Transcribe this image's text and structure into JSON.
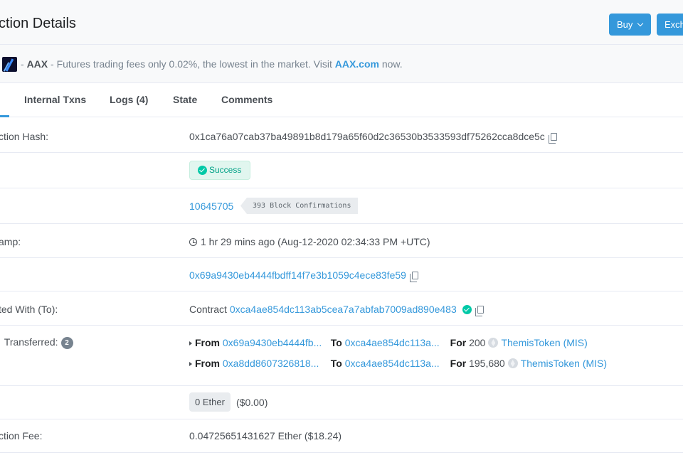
{
  "header": {
    "title": "ction Details",
    "buy_label": "Buy",
    "exchange_label": "Exch"
  },
  "sponsor": {
    "separator": "-",
    "brand": "AAX",
    "message": "- Futures trading fees only 0.02%, the lowest in the market. Visit",
    "link": "AAX.com",
    "suffix": "now."
  },
  "tabs": [
    {
      "label": "Internal Txns"
    },
    {
      "label": "Logs (4)"
    },
    {
      "label": "State"
    },
    {
      "label": "Comments"
    }
  ],
  "fields": {
    "tx_hash": {
      "label": "ction Hash:",
      "value": "0x1ca76a07cab37ba49891b8d179a65f60d2c36530b3533593df75262cca8dce5c"
    },
    "status": {
      "label": "",
      "value": "Success"
    },
    "block": {
      "label": "",
      "value": "10645705",
      "confirmations": "393 Block Confirmations"
    },
    "timestamp": {
      "label": "amp:",
      "value": "1 hr 29 mins ago (Aug-12-2020 02:34:33 PM +UTC)"
    },
    "from": {
      "label": "",
      "value": "0x69a9430eb4444fbdff14f7e3b1059c4ece83fe59"
    },
    "to": {
      "label": "ted With (To):",
      "prefix": "Contract",
      "value": "0xca4ae854dc113ab5cea7a7abfab7009ad890e483"
    },
    "tokens": {
      "label": "Transferred:",
      "count": "2",
      "from_kw": "From",
      "to_kw": "To",
      "for_kw": "For",
      "transfers": [
        {
          "from": "0x69a9430eb4444fb...",
          "to": "0xca4ae854dc113a...",
          "amount": "200",
          "token": "ThemisToken (MIS)"
        },
        {
          "from": "0xa8dd8607326818...",
          "to": "0xca4ae854dc113a...",
          "amount": "195,680",
          "token": "ThemisToken (MIS)"
        }
      ]
    },
    "value": {
      "label": "",
      "ether": "0 Ether",
      "usd": "($0.00)"
    },
    "fee": {
      "label": "ction Fee:",
      "value": "0.04725651431627 Ether ($18.24)"
    }
  }
}
